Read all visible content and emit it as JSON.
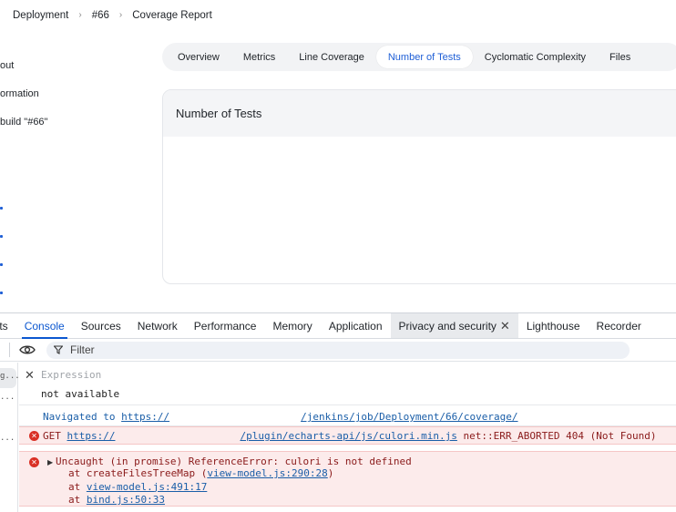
{
  "breadcrumb": {
    "items": [
      "Deployment",
      "#66",
      "Coverage Report"
    ],
    "separator": ">"
  },
  "sidebar": {
    "items": [
      "out",
      "ormation",
      "build \"#66\""
    ]
  },
  "tabs": {
    "items": [
      "Overview",
      "Metrics",
      "Line Coverage",
      "Number of Tests",
      "Cyclomatic Complexity",
      "Files"
    ],
    "active_index": 3
  },
  "card": {
    "title": "Number of Tests"
  },
  "devtools": {
    "tabs": [
      "ents",
      "Console",
      "Sources",
      "Network",
      "Performance",
      "Memory",
      "Application",
      "Privacy and security",
      "Lighthouse",
      "Recorder"
    ],
    "active_tab": "Console",
    "highlighted_tab": "Privacy and security",
    "filter_placeholder": "Filter",
    "gutter": [
      "g...",
      "...",
      "..."
    ],
    "expression": {
      "placeholder": "Expression",
      "value": "not available"
    },
    "messages": {
      "navigated_prefix": "Navigated to",
      "navigated_scheme": "https://",
      "navigated_path": "/jenkins/job/Deployment/66/coverage/",
      "get_prefix": "GET",
      "get_scheme": "https://",
      "get_path": "/plugin/echarts-api/js/culori.min.js",
      "get_error": "net::ERR_ABORTED 404 (Not Found)",
      "uncaught": "Uncaught (in promise) ReferenceError: culori is not defined",
      "stack": [
        {
          "prefix": "at createFilesTreeMap (",
          "link": "view-model.js:290:28",
          "suffix": ")"
        },
        {
          "prefix": "at ",
          "link": "view-model.js:491:17",
          "suffix": ""
        },
        {
          "prefix": "at ",
          "link": "bind.js:50:33",
          "suffix": ""
        }
      ]
    }
  },
  "colors": {
    "accent": "#1f5fd6",
    "devtools_active": "#0b57d0",
    "error_bg": "#fcebeb",
    "error_icon": "#d93025",
    "link": "#1a5ea8"
  }
}
